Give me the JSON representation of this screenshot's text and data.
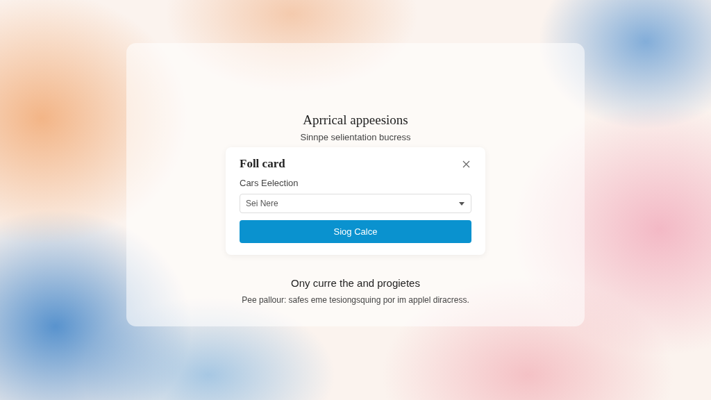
{
  "header": {
    "title": "Aprrical appeesions",
    "subtitle": "Sinnpe selientation bucress"
  },
  "card": {
    "title": "Foll card",
    "field_label": "Cars Eelection",
    "select": {
      "placeholder": "Sei Nere"
    },
    "button": "Siog Calce"
  },
  "footer": {
    "heading": "Ony curre the and progietes",
    "text": "Pee pallour: safes eme tesiongsquing por im applel diracress."
  }
}
